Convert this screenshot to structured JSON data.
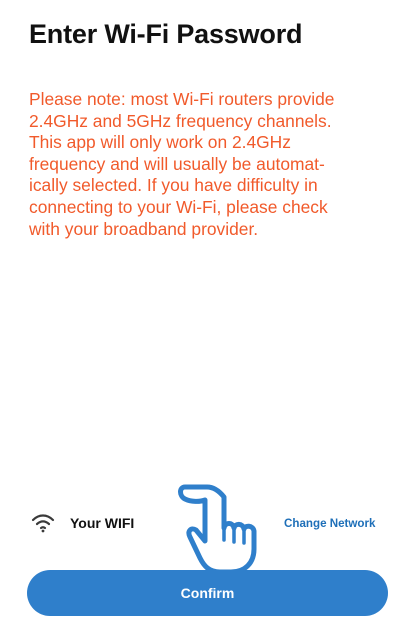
{
  "header": {
    "title": "Enter Wi-Fi Password"
  },
  "notice": {
    "text": "Please note: most Wi-Fi routers provide\n2.4GHz and 5GHz frequency channels.\nThis app will only work on 2.4GHz\nfrequency and will usually be automat-\nically selected. If you have difficulty in\nconnecting to your Wi-Fi, please check\nwith your broadband provider.",
    "color": "#f15a2b"
  },
  "network": {
    "icon": "wifi-icon",
    "name": "Your WIFI",
    "change_label": "Change Network",
    "link_color": "#1e6fb8"
  },
  "pointer": {
    "icon": "pointing-hand-icon"
  },
  "actions": {
    "confirm_label": "Confirm",
    "button_color": "#2f7fcb"
  }
}
